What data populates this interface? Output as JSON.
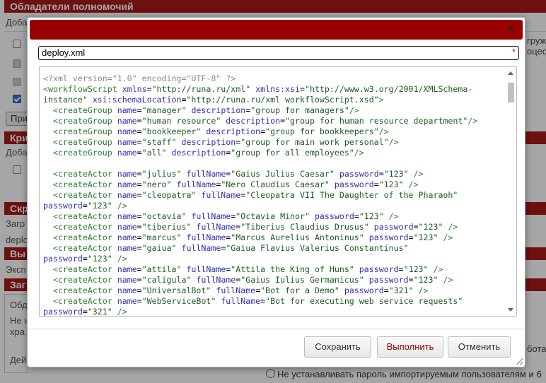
{
  "background": {
    "section1_title": "Обладатели полномочий",
    "section1_add": "Доба",
    "right_text_1": "груж",
    "right_text_2": "оцес",
    "apply_btn": "При",
    "section2_title": "Кри",
    "section2_add": "Доба",
    "section3_title": "Скр",
    "section3_load": "Загр",
    "section3_file": "deplo",
    "section4_title": "Вы",
    "section4_export": "Эксп",
    "section5_title": "Заг",
    "section5_add": "Обда",
    "section5_not": "Не н",
    "section5_store": "хра",
    "section5_action": "Дей",
    "right_bot": "бота",
    "radio_label": "Не устанавливать пароль импортируемым пользователям и б"
  },
  "dialog": {
    "close_icon": "×",
    "filename": "deploy.xml",
    "required_star": "*",
    "buttons": {
      "save": "Сохранить",
      "execute": "Выполнить",
      "cancel": "Отменить"
    },
    "code_lines": [
      [
        [
          "pi",
          "<?xml version=\"1.0\" encoding=\"UTF-8\" ?>"
        ]
      ],
      [
        [
          "tag",
          "<workflowScript "
        ],
        [
          "attr",
          "xmlns"
        ],
        [
          "p",
          "="
        ],
        [
          "val",
          "\"http://runa.ru/xml\""
        ],
        [
          "p",
          " "
        ],
        [
          "attr",
          "xmlns:xsi"
        ],
        [
          "p",
          "="
        ],
        [
          "val",
          "\"http://www.w3.org/2001/XMLSchema-"
        ]
      ],
      [
        [
          "val",
          "instance\""
        ],
        [
          "p",
          " "
        ],
        [
          "attr",
          "xsi:schemaLocation"
        ],
        [
          "p",
          "="
        ],
        [
          "val",
          "\"http://runa.ru/xml workflowScript.xsd\""
        ],
        [
          "tag",
          ">"
        ]
      ],
      [
        [
          "p",
          "  "
        ],
        [
          "tag",
          "<createGroup "
        ],
        [
          "attr",
          "name"
        ],
        [
          "p",
          "="
        ],
        [
          "val",
          "\"manager\""
        ],
        [
          "p",
          " "
        ],
        [
          "attr",
          "description"
        ],
        [
          "p",
          "="
        ],
        [
          "val",
          "\"group for managers\""
        ],
        [
          "tag",
          "/>"
        ]
      ],
      [
        [
          "p",
          "  "
        ],
        [
          "tag",
          "<createGroup "
        ],
        [
          "attr",
          "name"
        ],
        [
          "p",
          "="
        ],
        [
          "val",
          "\"human resource\""
        ],
        [
          "p",
          " "
        ],
        [
          "attr",
          "description"
        ],
        [
          "p",
          "="
        ],
        [
          "val",
          "\"group for human resource department\""
        ],
        [
          "tag",
          "/>"
        ]
      ],
      [
        [
          "p",
          "  "
        ],
        [
          "tag",
          "<createGroup "
        ],
        [
          "attr",
          "name"
        ],
        [
          "p",
          "="
        ],
        [
          "val",
          "\"bookkeeper\""
        ],
        [
          "p",
          " "
        ],
        [
          "attr",
          "description"
        ],
        [
          "p",
          "="
        ],
        [
          "val",
          "\"group for bookkeepers\""
        ],
        [
          "tag",
          "/>"
        ]
      ],
      [
        [
          "p",
          "  "
        ],
        [
          "tag",
          "<createGroup "
        ],
        [
          "attr",
          "name"
        ],
        [
          "p",
          "="
        ],
        [
          "val",
          "\"staff\""
        ],
        [
          "p",
          " "
        ],
        [
          "attr",
          "description"
        ],
        [
          "p",
          "="
        ],
        [
          "val",
          "\"group for main work personal\""
        ],
        [
          "tag",
          "/>"
        ]
      ],
      [
        [
          "p",
          "  "
        ],
        [
          "tag",
          "<createGroup "
        ],
        [
          "attr",
          "name"
        ],
        [
          "p",
          "="
        ],
        [
          "val",
          "\"all\""
        ],
        [
          "p",
          " "
        ],
        [
          "attr",
          "description"
        ],
        [
          "p",
          "="
        ],
        [
          "val",
          "\"group for all employees\""
        ],
        [
          "tag",
          "/>"
        ]
      ],
      [
        [
          "p",
          ""
        ]
      ],
      [
        [
          "p",
          "  "
        ],
        [
          "tag",
          "<createActor "
        ],
        [
          "attr",
          "name"
        ],
        [
          "p",
          "="
        ],
        [
          "val",
          "\"julius\""
        ],
        [
          "p",
          " "
        ],
        [
          "attr",
          "fullName"
        ],
        [
          "p",
          "="
        ],
        [
          "val",
          "\"Gaius Julius Caesar\""
        ],
        [
          "p",
          " "
        ],
        [
          "attr",
          "password"
        ],
        [
          "p",
          "="
        ],
        [
          "val",
          "\"123\""
        ],
        [
          "p",
          " "
        ],
        [
          "tag",
          "/>"
        ]
      ],
      [
        [
          "p",
          "  "
        ],
        [
          "tag",
          "<createActor "
        ],
        [
          "attr",
          "name"
        ],
        [
          "p",
          "="
        ],
        [
          "val",
          "\"nero\""
        ],
        [
          "p",
          " "
        ],
        [
          "attr",
          "fullName"
        ],
        [
          "p",
          "="
        ],
        [
          "val",
          "\"Nero Claudius Caesar\""
        ],
        [
          "p",
          " "
        ],
        [
          "attr",
          "password"
        ],
        [
          "p",
          "="
        ],
        [
          "val",
          "\"123\""
        ],
        [
          "p",
          " "
        ],
        [
          "tag",
          "/>"
        ]
      ],
      [
        [
          "p",
          "  "
        ],
        [
          "tag",
          "<createActor "
        ],
        [
          "attr",
          "name"
        ],
        [
          "p",
          "="
        ],
        [
          "val",
          "\"cleopatra\""
        ],
        [
          "p",
          " "
        ],
        [
          "attr",
          "fullName"
        ],
        [
          "p",
          "="
        ],
        [
          "val",
          "\"Cleopatra VII The Daughter of the Pharaoh\""
        ]
      ],
      [
        [
          "attr",
          "password"
        ],
        [
          "p",
          "="
        ],
        [
          "val",
          "\"123\""
        ],
        [
          "p",
          " "
        ],
        [
          "tag",
          "/>"
        ]
      ],
      [
        [
          "p",
          "  "
        ],
        [
          "tag",
          "<createActor "
        ],
        [
          "attr",
          "name"
        ],
        [
          "p",
          "="
        ],
        [
          "val",
          "\"octavia\""
        ],
        [
          "p",
          " "
        ],
        [
          "attr",
          "fullName"
        ],
        [
          "p",
          "="
        ],
        [
          "val",
          "\"Octavia Minor\""
        ],
        [
          "p",
          " "
        ],
        [
          "attr",
          "password"
        ],
        [
          "p",
          "="
        ],
        [
          "val",
          "\"123\""
        ],
        [
          "p",
          " "
        ],
        [
          "tag",
          "/>"
        ]
      ],
      [
        [
          "p",
          "  "
        ],
        [
          "tag",
          "<createActor "
        ],
        [
          "attr",
          "name"
        ],
        [
          "p",
          "="
        ],
        [
          "val",
          "\"tiberius\""
        ],
        [
          "p",
          " "
        ],
        [
          "attr",
          "fullName"
        ],
        [
          "p",
          "="
        ],
        [
          "val",
          "\"Tiberius Claudius Drusus\""
        ],
        [
          "p",
          " "
        ],
        [
          "attr",
          "password"
        ],
        [
          "p",
          "="
        ],
        [
          "val",
          "\"123\""
        ],
        [
          "p",
          " "
        ],
        [
          "tag",
          "/>"
        ]
      ],
      [
        [
          "p",
          "  "
        ],
        [
          "tag",
          "<createActor "
        ],
        [
          "attr",
          "name"
        ],
        [
          "p",
          "="
        ],
        [
          "val",
          "\"marcus\""
        ],
        [
          "p",
          " "
        ],
        [
          "attr",
          "fullName"
        ],
        [
          "p",
          "="
        ],
        [
          "val",
          "\"Marcus Aurelius Antoninus\""
        ],
        [
          "p",
          " "
        ],
        [
          "attr",
          "password"
        ],
        [
          "p",
          "="
        ],
        [
          "val",
          "\"123\""
        ],
        [
          "p",
          " "
        ],
        [
          "tag",
          "/>"
        ]
      ],
      [
        [
          "p",
          "  "
        ],
        [
          "tag",
          "<createActor "
        ],
        [
          "attr",
          "name"
        ],
        [
          "p",
          "="
        ],
        [
          "val",
          "\"gaiua\""
        ],
        [
          "p",
          " "
        ],
        [
          "attr",
          "fullName"
        ],
        [
          "p",
          "="
        ],
        [
          "val",
          "\"Gaiua Flavius Valerius Constantinus\""
        ]
      ],
      [
        [
          "attr",
          "password"
        ],
        [
          "p",
          "="
        ],
        [
          "val",
          "\"123\""
        ],
        [
          "p",
          " "
        ],
        [
          "tag",
          "/>"
        ]
      ],
      [
        [
          "p",
          "  "
        ],
        [
          "tag",
          "<createActor "
        ],
        [
          "attr",
          "name"
        ],
        [
          "p",
          "="
        ],
        [
          "val",
          "\"attila\""
        ],
        [
          "p",
          " "
        ],
        [
          "attr",
          "fullName"
        ],
        [
          "p",
          "="
        ],
        [
          "val",
          "\"Attila the King of Huns\""
        ],
        [
          "p",
          " "
        ],
        [
          "attr",
          "password"
        ],
        [
          "p",
          "="
        ],
        [
          "val",
          "\"123\""
        ],
        [
          "p",
          " "
        ],
        [
          "tag",
          "/>"
        ]
      ],
      [
        [
          "p",
          "  "
        ],
        [
          "tag",
          "<createActor "
        ],
        [
          "attr",
          "name"
        ],
        [
          "p",
          "="
        ],
        [
          "val",
          "\"caligula\""
        ],
        [
          "p",
          " "
        ],
        [
          "attr",
          "fullName"
        ],
        [
          "p",
          "="
        ],
        [
          "val",
          "\"Gaius Iulius Germanicus\""
        ],
        [
          "p",
          " "
        ],
        [
          "attr",
          "password"
        ],
        [
          "p",
          "="
        ],
        [
          "val",
          "\"123\""
        ],
        [
          "p",
          " "
        ],
        [
          "tag",
          "/>"
        ]
      ],
      [
        [
          "p",
          "  "
        ],
        [
          "tag",
          "<createActor "
        ],
        [
          "attr",
          "name"
        ],
        [
          "p",
          "="
        ],
        [
          "val",
          "\"UniversalBot\""
        ],
        [
          "p",
          " "
        ],
        [
          "attr",
          "fullName"
        ],
        [
          "p",
          "="
        ],
        [
          "val",
          "\"Bot for a Demo\""
        ],
        [
          "p",
          " "
        ],
        [
          "attr",
          "password"
        ],
        [
          "p",
          "="
        ],
        [
          "val",
          "\"321\""
        ],
        [
          "p",
          " "
        ],
        [
          "tag",
          "/>"
        ]
      ],
      [
        [
          "p",
          "  "
        ],
        [
          "tag",
          "<createActor "
        ],
        [
          "attr",
          "name"
        ],
        [
          "p",
          "="
        ],
        [
          "val",
          "\"WebServiceBot\""
        ],
        [
          "p",
          " "
        ],
        [
          "attr",
          "fullName"
        ],
        [
          "p",
          "="
        ],
        [
          "val",
          "\"Bot for executing web service requests\""
        ]
      ],
      [
        [
          "attr",
          "password"
        ],
        [
          "p",
          "="
        ],
        [
          "val",
          "\"321\""
        ],
        [
          "p",
          " "
        ],
        [
          "tag",
          "/>"
        ]
      ]
    ]
  },
  "colors": {
    "title_bar": "#990000",
    "section_header": "#a81a1a",
    "xml_tag": "#2e7d32",
    "xml_attr": "#3030b0",
    "xml_value": "#1b5e20",
    "xml_pi": "#888888",
    "execute_text": "#8b0000"
  }
}
